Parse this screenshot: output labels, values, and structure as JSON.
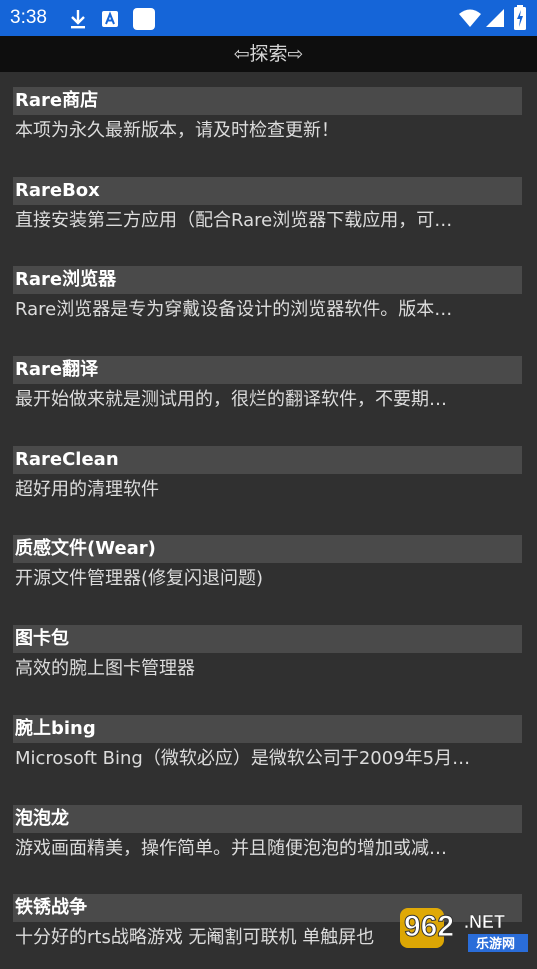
{
  "status_bar": {
    "time": "3:38",
    "icons_left": [
      "download-icon",
      "accessibility-icon",
      "square-notification-icon"
    ],
    "icons_right": [
      "wifi-icon",
      "signal-icon",
      "battery-charging-icon"
    ],
    "background": "#1565d8"
  },
  "app_bar": {
    "title": "⇦探索⇨",
    "background": "#0e0e0e"
  },
  "items": [
    {
      "title": "Rare商店",
      "desc": "本项为永久最新版本，请及时检查更新！"
    },
    {
      "title": "RareBox",
      "desc": "直接安装第三方应用（配合Rare浏览器下载应用，可…"
    },
    {
      "title": "Rare浏览器",
      "desc": "Rare浏览器是专为穿戴设备设计的浏览器软件。版本…"
    },
    {
      "title": "Rare翻译",
      "desc": "最开始做来就是测试用的，很烂的翻译软件，不要期…"
    },
    {
      "title": "RareClean",
      "desc": "超好用的清理软件"
    },
    {
      "title": "质感文件(Wear)",
      "desc": "开源文件管理器(修复闪退问题)"
    },
    {
      "title": "图卡包",
      "desc": "高效的腕上图卡管理器"
    },
    {
      "title": "腕上bing",
      "desc": "Microsoft Bing（微软必应）是微软公司于2009年5月…"
    },
    {
      "title": "泡泡龙",
      "desc": "游戏画面精美，操作简单。并且随便泡泡的增加或减…"
    },
    {
      "title": "铁锈战争",
      "desc": "十分好的rts战略游戏 无阉割可联机 单触屏也"
    }
  ],
  "watermark": {
    "number": "962",
    "suffix": ".NET",
    "subtitle": "乐游网"
  }
}
